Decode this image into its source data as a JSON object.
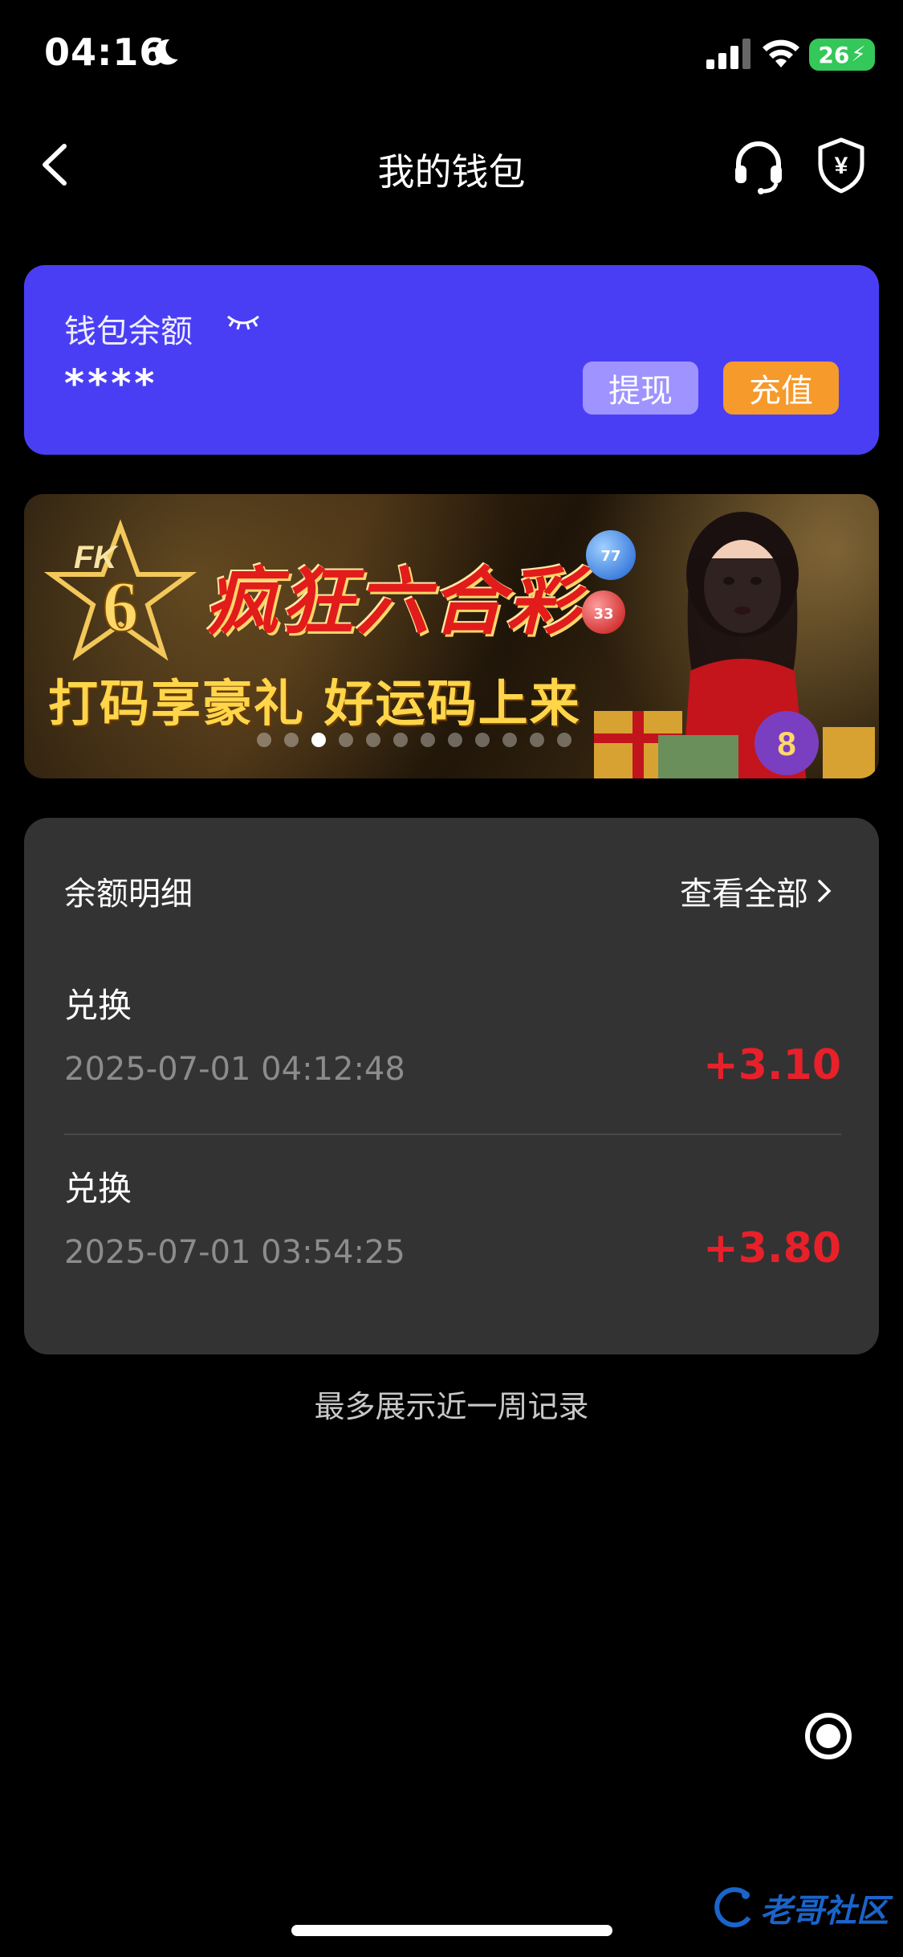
{
  "status_bar": {
    "time": "04:16",
    "battery": "26"
  },
  "nav": {
    "title": "我的钱包"
  },
  "wallet": {
    "label": "钱包余额",
    "balance_masked": "****",
    "withdraw_label": "提现",
    "recharge_label": "充值"
  },
  "banner": {
    "logo_text": "FK",
    "title": "疯狂六合彩",
    "subtitle": "打码享豪礼 好运码上来",
    "ball_1": "77",
    "ball_2": "33",
    "slide_count": 12,
    "active_slide": 3
  },
  "details": {
    "title": "余额明细",
    "view_all_label": "查看全部",
    "records": [
      {
        "title": "兑换",
        "time": "2025-07-01 04:12:48",
        "amount": "+3.10"
      },
      {
        "title": "兑换",
        "time": "2025-07-01 03:54:25",
        "amount": "+3.80"
      }
    ]
  },
  "footnote": "最多展示近一周记录",
  "watermark": "老哥社区",
  "colors": {
    "background": "#000000",
    "wallet_card": "#4a3ef5",
    "withdraw_button": "#9e93ff",
    "recharge_button": "#f59a2b",
    "details_card": "#333333",
    "amount_positive": "#e8202a"
  }
}
